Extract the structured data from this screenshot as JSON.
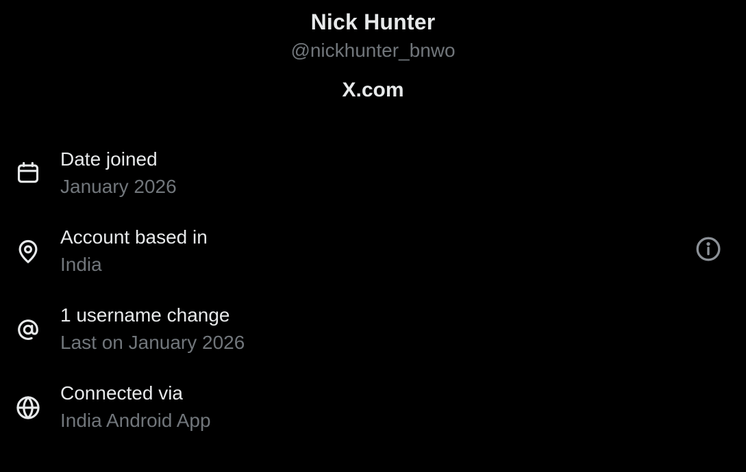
{
  "profile": {
    "display_name": "Nick Hunter",
    "handle": "@nickhunter_bnwo",
    "site": "X.com"
  },
  "about_items": [
    {
      "icon": "calendar-icon",
      "title": "Date joined",
      "subtitle": "January 2026"
    },
    {
      "icon": "location-pin-icon",
      "title": "Account based in",
      "subtitle": "India"
    },
    {
      "icon": "at-sign-icon",
      "title": "1 username change",
      "subtitle": "Last on January 2026"
    },
    {
      "icon": "globe-icon",
      "title": "Connected via",
      "subtitle": "India Android App"
    }
  ],
  "colors": {
    "background": "#000000",
    "primary_text": "#e7e9ea",
    "secondary_text": "#71767b"
  }
}
